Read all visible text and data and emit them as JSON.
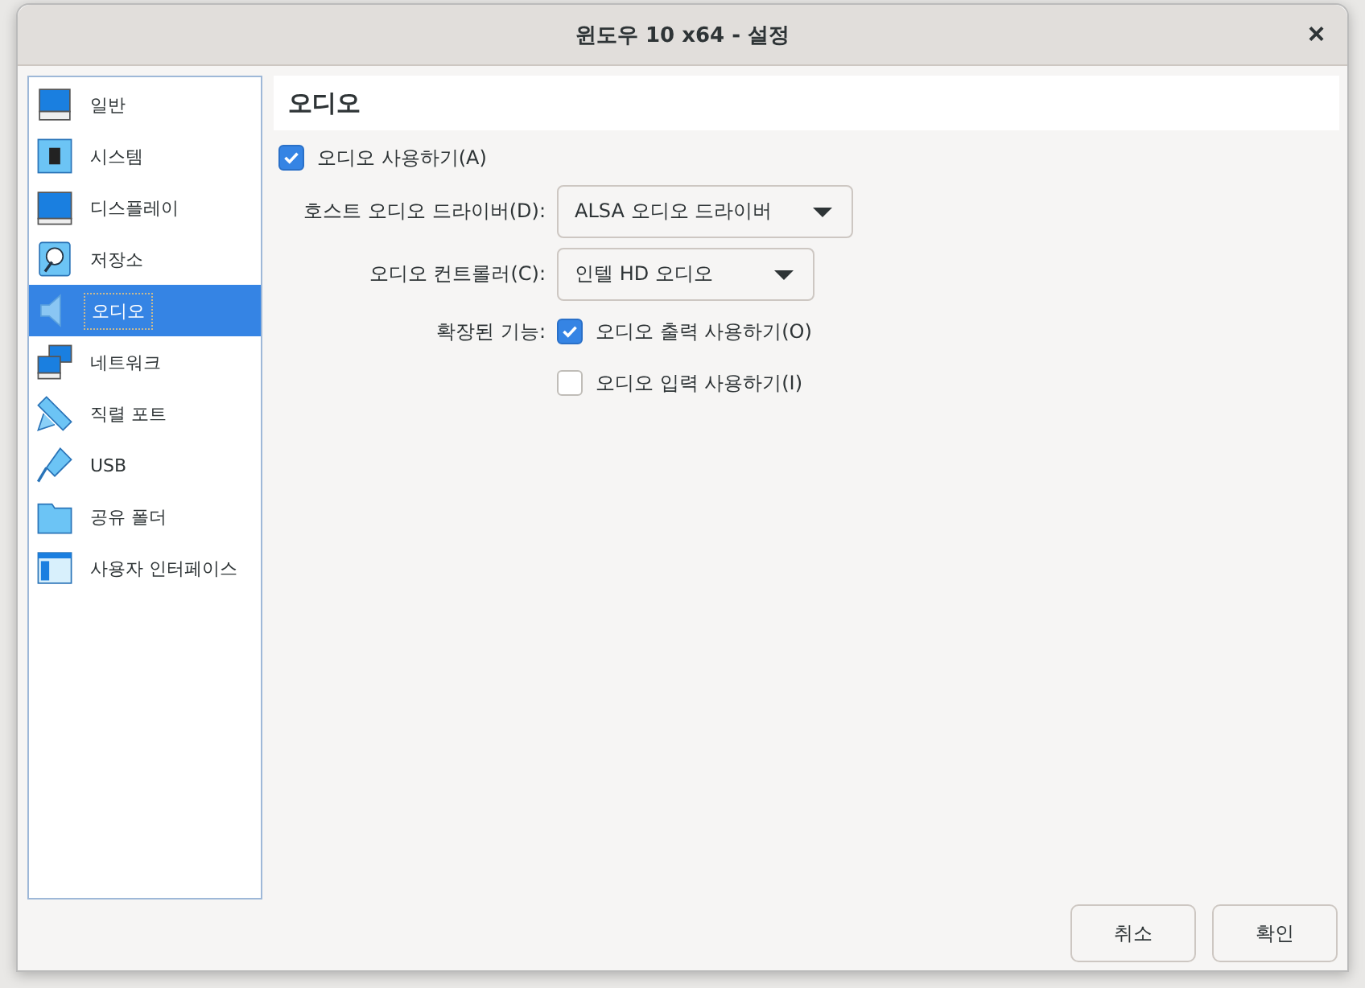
{
  "window": {
    "title": "윈도우 10 x64 - 설정",
    "close": "×"
  },
  "sidebar": {
    "items": [
      {
        "label": "일반",
        "selected": false
      },
      {
        "label": "시스템",
        "selected": false
      },
      {
        "label": "디스플레이",
        "selected": false
      },
      {
        "label": "저장소",
        "selected": false
      },
      {
        "label": "오디오",
        "selected": true
      },
      {
        "label": "네트워크",
        "selected": false
      },
      {
        "label": "직렬 포트",
        "selected": false
      },
      {
        "label": "USB",
        "selected": false
      },
      {
        "label": "공유 폴더",
        "selected": false
      },
      {
        "label": "사용자 인터페이스",
        "selected": false
      }
    ]
  },
  "page": {
    "title": "오디오",
    "enable": {
      "label": "오디오 사용하기(A)",
      "checked": true
    },
    "host_driver": {
      "label": "호스트 오디오 드라이버(D):",
      "value": "ALSA 오디오 드라이버"
    },
    "controller": {
      "label": "오디오 컨트롤러(C):",
      "value": "인텔 HD 오디오"
    },
    "extended": {
      "label": "확장된 기능:",
      "options": [
        {
          "label": "오디오 출력 사용하기(O)",
          "checked": true
        },
        {
          "label": "오디오 입력 사용하기(I)",
          "checked": false
        }
      ]
    }
  },
  "buttons": [
    "취소",
    "확인"
  ]
}
